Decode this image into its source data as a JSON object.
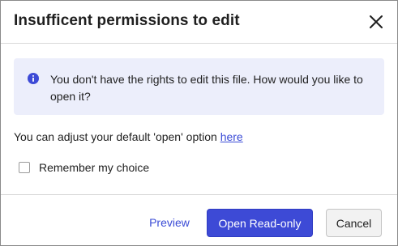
{
  "dialog": {
    "title": "Insufficent permissions to edit",
    "close_icon": "close-icon"
  },
  "info": {
    "icon": "info-icon",
    "message": "You don't have the rights to edit this file. How would you like to open it?"
  },
  "adjust": {
    "text": "You can adjust your default 'open' option ",
    "link_label": "here"
  },
  "remember": {
    "label": "Remember my choice",
    "checked": false
  },
  "footer": {
    "preview_label": "Preview",
    "open_readonly_label": "Open Read-only",
    "cancel_label": "Cancel"
  },
  "colors": {
    "accent": "#3d4ad6",
    "info_background": "#eceefb",
    "link": "#3a4bd6"
  }
}
